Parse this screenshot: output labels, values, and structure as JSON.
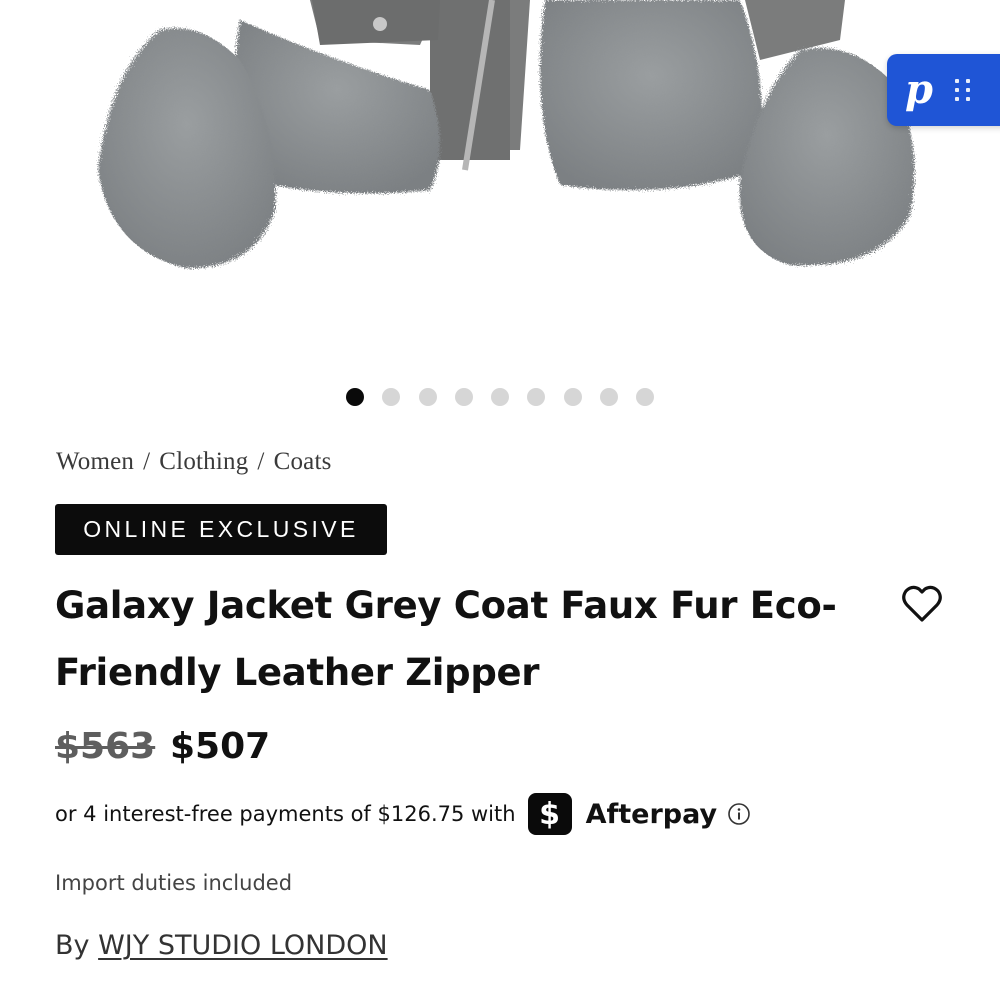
{
  "product_image": {
    "icon": "fur-jacket-image",
    "colors": {
      "fur": "#8a8d8f",
      "leather": "#7b7c7c"
    }
  },
  "pin_button": {
    "letter": "p",
    "icon": "pinterest-icon",
    "color": "#1f55d6"
  },
  "carousel": {
    "count": 9,
    "active": 1
  },
  "breadcrumb": [
    "Women",
    "Clothing",
    "Coats"
  ],
  "badge": "ONLINE EXCLUSIVE",
  "product": {
    "title": "Galaxy Jacket Grey Coat Faux Fur Eco-Friendly Leather Zipper",
    "price_old": "$563",
    "price_new": "$507"
  },
  "afterpay": {
    "text": "or 4 interest-free payments of $126.75 with",
    "logo_glyph": "$",
    "name": "Afterpay",
    "info_icon": "info-circle-icon"
  },
  "duties": "Import duties included",
  "brand": {
    "prefix": "By",
    "name": "WJY STUDIO LONDON"
  },
  "wishlist_icon": "heart-icon"
}
